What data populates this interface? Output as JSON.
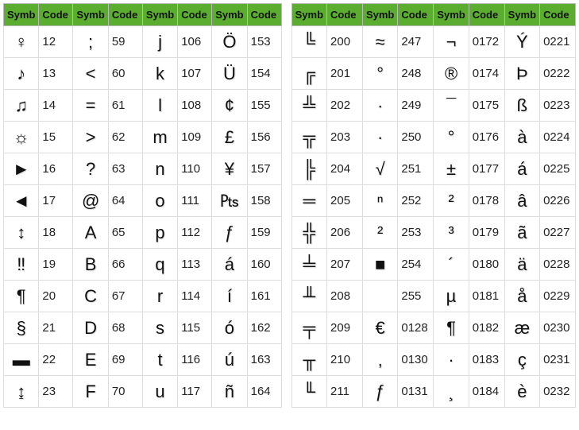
{
  "headers": {
    "symb": "Symb",
    "code": "Code"
  },
  "left": {
    "cols": [
      [
        {
          "s": "♀",
          "c": "12"
        },
        {
          "s": "♪",
          "c": "13"
        },
        {
          "s": "♫",
          "c": "14"
        },
        {
          "s": "☼",
          "c": "15"
        },
        {
          "s": "►",
          "c": "16"
        },
        {
          "s": "◄",
          "c": "17"
        },
        {
          "s": "↕",
          "c": "18"
        },
        {
          "s": "‼",
          "c": "19"
        },
        {
          "s": "¶",
          "c": "20"
        },
        {
          "s": "§",
          "c": "21"
        },
        {
          "s": "▬",
          "c": "22"
        },
        {
          "s": "↨",
          "c": "23"
        }
      ],
      [
        {
          "s": ";",
          "c": "59"
        },
        {
          "s": "<",
          "c": "60"
        },
        {
          "s": "=",
          "c": "61"
        },
        {
          "s": ">",
          "c": "62"
        },
        {
          "s": "?",
          "c": "63"
        },
        {
          "s": "@",
          "c": "64"
        },
        {
          "s": "A",
          "c": "65"
        },
        {
          "s": "B",
          "c": "66"
        },
        {
          "s": "C",
          "c": "67"
        },
        {
          "s": "D",
          "c": "68"
        },
        {
          "s": "E",
          "c": "69"
        },
        {
          "s": "F",
          "c": "70"
        }
      ],
      [
        {
          "s": "j",
          "c": "106"
        },
        {
          "s": "k",
          "c": "107"
        },
        {
          "s": "l",
          "c": "108"
        },
        {
          "s": "m",
          "c": "109"
        },
        {
          "s": "n",
          "c": "110"
        },
        {
          "s": "o",
          "c": "111"
        },
        {
          "s": "p",
          "c": "112"
        },
        {
          "s": "q",
          "c": "113"
        },
        {
          "s": "r",
          "c": "114"
        },
        {
          "s": "s",
          "c": "115"
        },
        {
          "s": "t",
          "c": "116"
        },
        {
          "s": "u",
          "c": "117"
        }
      ],
      [
        {
          "s": "Ö",
          "c": "153"
        },
        {
          "s": "Ü",
          "c": "154"
        },
        {
          "s": "¢",
          "c": "155"
        },
        {
          "s": "£",
          "c": "156"
        },
        {
          "s": "¥",
          "c": "157"
        },
        {
          "s": "₧",
          "c": "158"
        },
        {
          "s": "ƒ",
          "c": "159"
        },
        {
          "s": "á",
          "c": "160"
        },
        {
          "s": "í",
          "c": "161"
        },
        {
          "s": "ó",
          "c": "162"
        },
        {
          "s": "ú",
          "c": "163"
        },
        {
          "s": "ñ",
          "c": "164"
        }
      ]
    ]
  },
  "right": {
    "cols": [
      [
        {
          "s": "╚",
          "c": "200"
        },
        {
          "s": "╔",
          "c": "201"
        },
        {
          "s": "╩",
          "c": "202"
        },
        {
          "s": "╦",
          "c": "203"
        },
        {
          "s": "╠",
          "c": "204"
        },
        {
          "s": "═",
          "c": "205"
        },
        {
          "s": "╬",
          "c": "206"
        },
        {
          "s": "╧",
          "c": "207"
        },
        {
          "s": "╨",
          "c": "208"
        },
        {
          "s": "╤",
          "c": "209"
        },
        {
          "s": "╥",
          "c": "210"
        },
        {
          "s": "╙",
          "c": "211"
        }
      ],
      [
        {
          "s": "≈",
          "c": "247"
        },
        {
          "s": "°",
          "c": "248"
        },
        {
          "s": "∙",
          "c": "249"
        },
        {
          "s": "·",
          "c": "250"
        },
        {
          "s": "√",
          "c": "251"
        },
        {
          "s": "ⁿ",
          "c": "252"
        },
        {
          "s": "²",
          "c": "253"
        },
        {
          "s": "■",
          "c": "254"
        },
        {
          "s": " ",
          "c": "255"
        },
        {
          "s": "€",
          "c": "0128"
        },
        {
          "s": "‚",
          "c": "0130"
        },
        {
          "s": "ƒ",
          "c": "0131"
        }
      ],
      [
        {
          "s": "¬",
          "c": "0172"
        },
        {
          "s": "®",
          "c": "0174"
        },
        {
          "s": "¯",
          "c": "0175"
        },
        {
          "s": "°",
          "c": "0176"
        },
        {
          "s": "±",
          "c": "0177"
        },
        {
          "s": "²",
          "c": "0178"
        },
        {
          "s": "³",
          "c": "0179"
        },
        {
          "s": "´",
          "c": "0180"
        },
        {
          "s": "µ",
          "c": "0181"
        },
        {
          "s": "¶",
          "c": "0182"
        },
        {
          "s": "·",
          "c": "0183"
        },
        {
          "s": "¸",
          "c": "0184"
        }
      ],
      [
        {
          "s": "Ý",
          "c": "0221"
        },
        {
          "s": "Þ",
          "c": "0222"
        },
        {
          "s": "ß",
          "c": "0223"
        },
        {
          "s": "à",
          "c": "0224"
        },
        {
          "s": "á",
          "c": "0225"
        },
        {
          "s": "â",
          "c": "0226"
        },
        {
          "s": "ã",
          "c": "0227"
        },
        {
          "s": "ä",
          "c": "0228"
        },
        {
          "s": "å",
          "c": "0229"
        },
        {
          "s": "æ",
          "c": "0230"
        },
        {
          "s": "ç",
          "c": "0231"
        },
        {
          "s": "è",
          "c": "0232"
        }
      ]
    ]
  }
}
